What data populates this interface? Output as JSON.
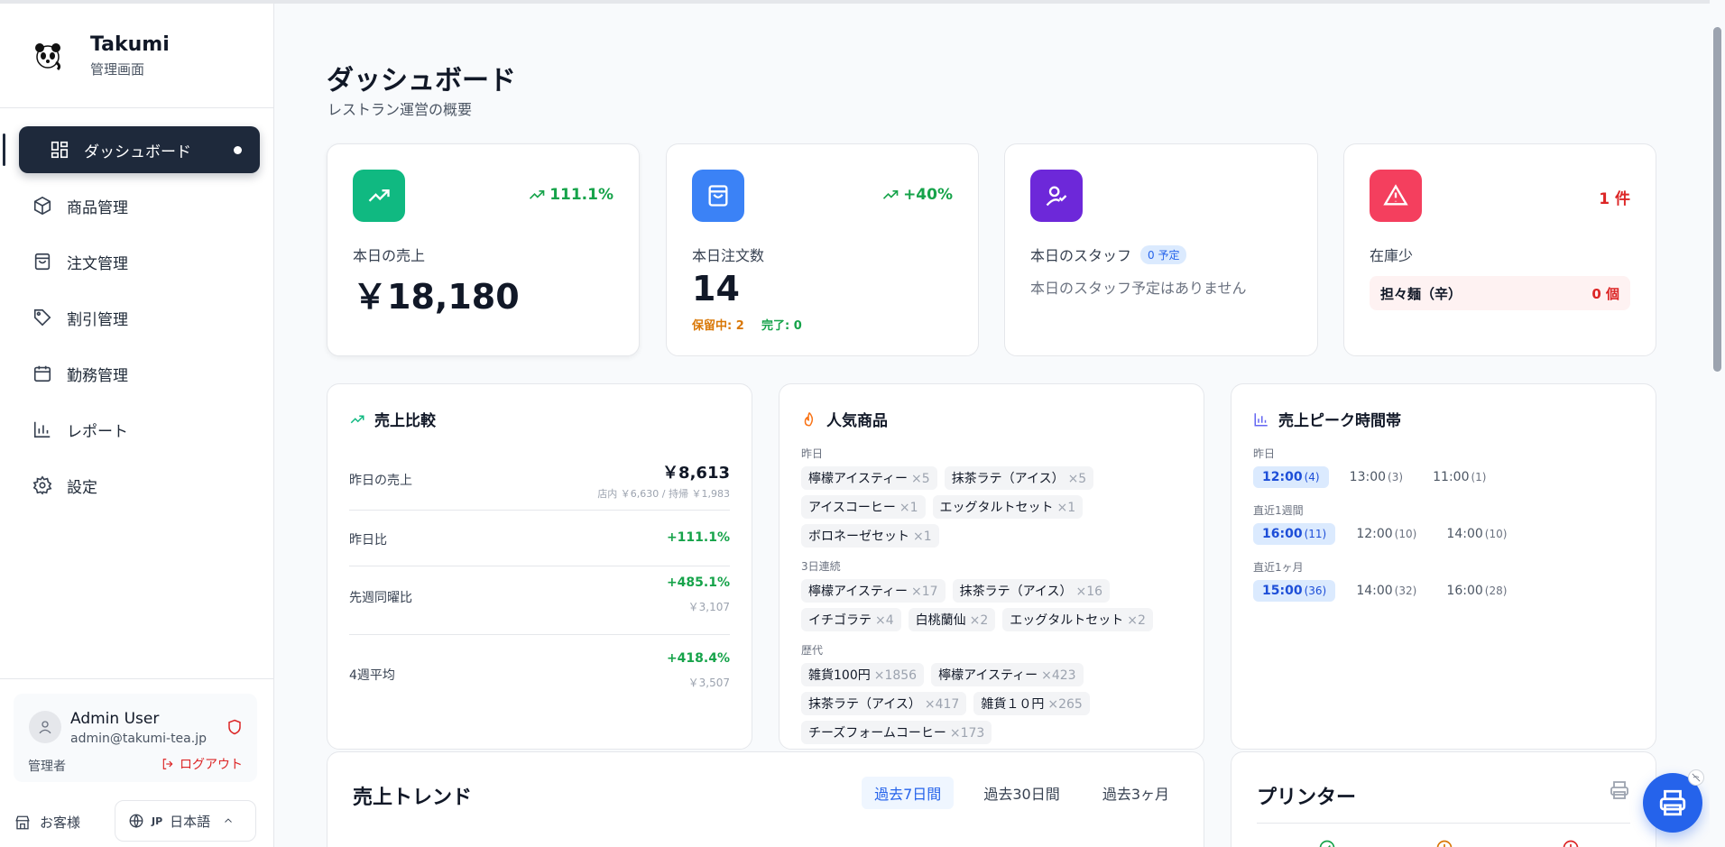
{
  "brand": {
    "name": "Takumi",
    "subtitle": "管理画面"
  },
  "nav": {
    "items": [
      {
        "label": "ダッシュボード",
        "icon": "grid-icon",
        "active": true
      },
      {
        "label": "商品管理",
        "icon": "box-icon"
      },
      {
        "label": "注文管理",
        "icon": "bag-icon"
      },
      {
        "label": "割引管理",
        "icon": "tag-icon"
      },
      {
        "label": "勤務管理",
        "icon": "calendar-icon"
      },
      {
        "label": "レポート",
        "icon": "bar-chart-icon"
      },
      {
        "label": "設定",
        "icon": "gear-icon"
      }
    ]
  },
  "user": {
    "name": "Admin User",
    "email": "admin@takumi-tea.jp",
    "role": "管理者",
    "logout": "ログアウト"
  },
  "footer": {
    "customer": "お客様",
    "lang_code": "JP",
    "lang_label": "日本語"
  },
  "page": {
    "title": "ダッシュボード",
    "subtitle": "レストラン運営の概要"
  },
  "stats": {
    "sales": {
      "trend": "111.1%",
      "label": "本日の売上",
      "value": "￥18,180",
      "color": "#10b981"
    },
    "orders": {
      "trend": "+40%",
      "label": "本日注文数",
      "value": "14",
      "pending": "保留中: 2",
      "done": "完了: 0",
      "color": "#3b82f6"
    },
    "staff": {
      "label": "本日のスタッフ",
      "badge": "0 予定",
      "empty": "本日のスタッフ予定はありません",
      "color": "#6d28d9"
    },
    "stock": {
      "count": "1 件",
      "label": "在庫少",
      "item_name": "担々麺（辛）",
      "item_qty": "0 個",
      "color": "#e11d48"
    }
  },
  "comparison": {
    "title": "売上比較",
    "rows": [
      {
        "label": "昨日の売上",
        "main": "￥8,613",
        "sub": "店内 ￥6,630 / 持帰 ￥1,983"
      },
      {
        "label": "昨日比",
        "pct": "+111.1%"
      },
      {
        "label": "先週同曜比",
        "pct": "+485.1%",
        "sub": "￥3,107"
      },
      {
        "label": "4週平均",
        "pct": "+418.4%",
        "sub": "￥3,507"
      }
    ]
  },
  "popular": {
    "title": "人気商品",
    "groups": [
      {
        "label": "昨日",
        "items": [
          {
            "name": "檸檬アイスティー",
            "count": "×5"
          },
          {
            "name": "抹茶ラテ（アイス）",
            "count": "×5"
          },
          {
            "name": "アイスコーヒー",
            "count": "×1"
          },
          {
            "name": "エッグタルトセット",
            "count": "×1"
          },
          {
            "name": "ボロネーゼセット",
            "count": "×1"
          }
        ]
      },
      {
        "label": "3日連続",
        "items": [
          {
            "name": "檸檬アイスティー",
            "count": "×17"
          },
          {
            "name": "抹茶ラテ（アイス）",
            "count": "×16"
          },
          {
            "name": "イチゴラテ",
            "count": "×4"
          },
          {
            "name": "白桃蘭仙",
            "count": "×2"
          },
          {
            "name": "エッグタルトセット",
            "count": "×2"
          }
        ]
      },
      {
        "label": "歴代",
        "items": [
          {
            "name": "雑貨100円",
            "count": "×1856"
          },
          {
            "name": "檸檬アイスティー",
            "count": "×423"
          },
          {
            "name": "抹茶ラテ（アイス）",
            "count": "×417"
          },
          {
            "name": "雑貨１０円",
            "count": "×265"
          },
          {
            "name": "チーズフォームコーヒー",
            "count": "×173"
          }
        ]
      }
    ]
  },
  "peak": {
    "title": "売上ピーク時間帯",
    "groups": [
      {
        "label": "昨日",
        "slots": [
          {
            "time": "12:00",
            "count": "(4)",
            "hot": true
          },
          {
            "time": "13:00",
            "count": "(3)"
          },
          {
            "time": "11:00",
            "count": "(1)"
          }
        ]
      },
      {
        "label": "直近1週間",
        "slots": [
          {
            "time": "16:00",
            "count": "(11)",
            "hot": true
          },
          {
            "time": "12:00",
            "count": "(10)"
          },
          {
            "time": "14:00",
            "count": "(10)"
          }
        ]
      },
      {
        "label": "直近1ヶ月",
        "slots": [
          {
            "time": "15:00",
            "count": "(36)",
            "hot": true
          },
          {
            "time": "14:00",
            "count": "(32)"
          },
          {
            "time": "16:00",
            "count": "(28)"
          }
        ]
      }
    ]
  },
  "trend": {
    "title": "売上トレンド",
    "tabs": [
      "過去7日間",
      "過去30日間",
      "過去3ヶ月"
    ],
    "active_tab": 0
  },
  "printer": {
    "title": "プリンター"
  }
}
